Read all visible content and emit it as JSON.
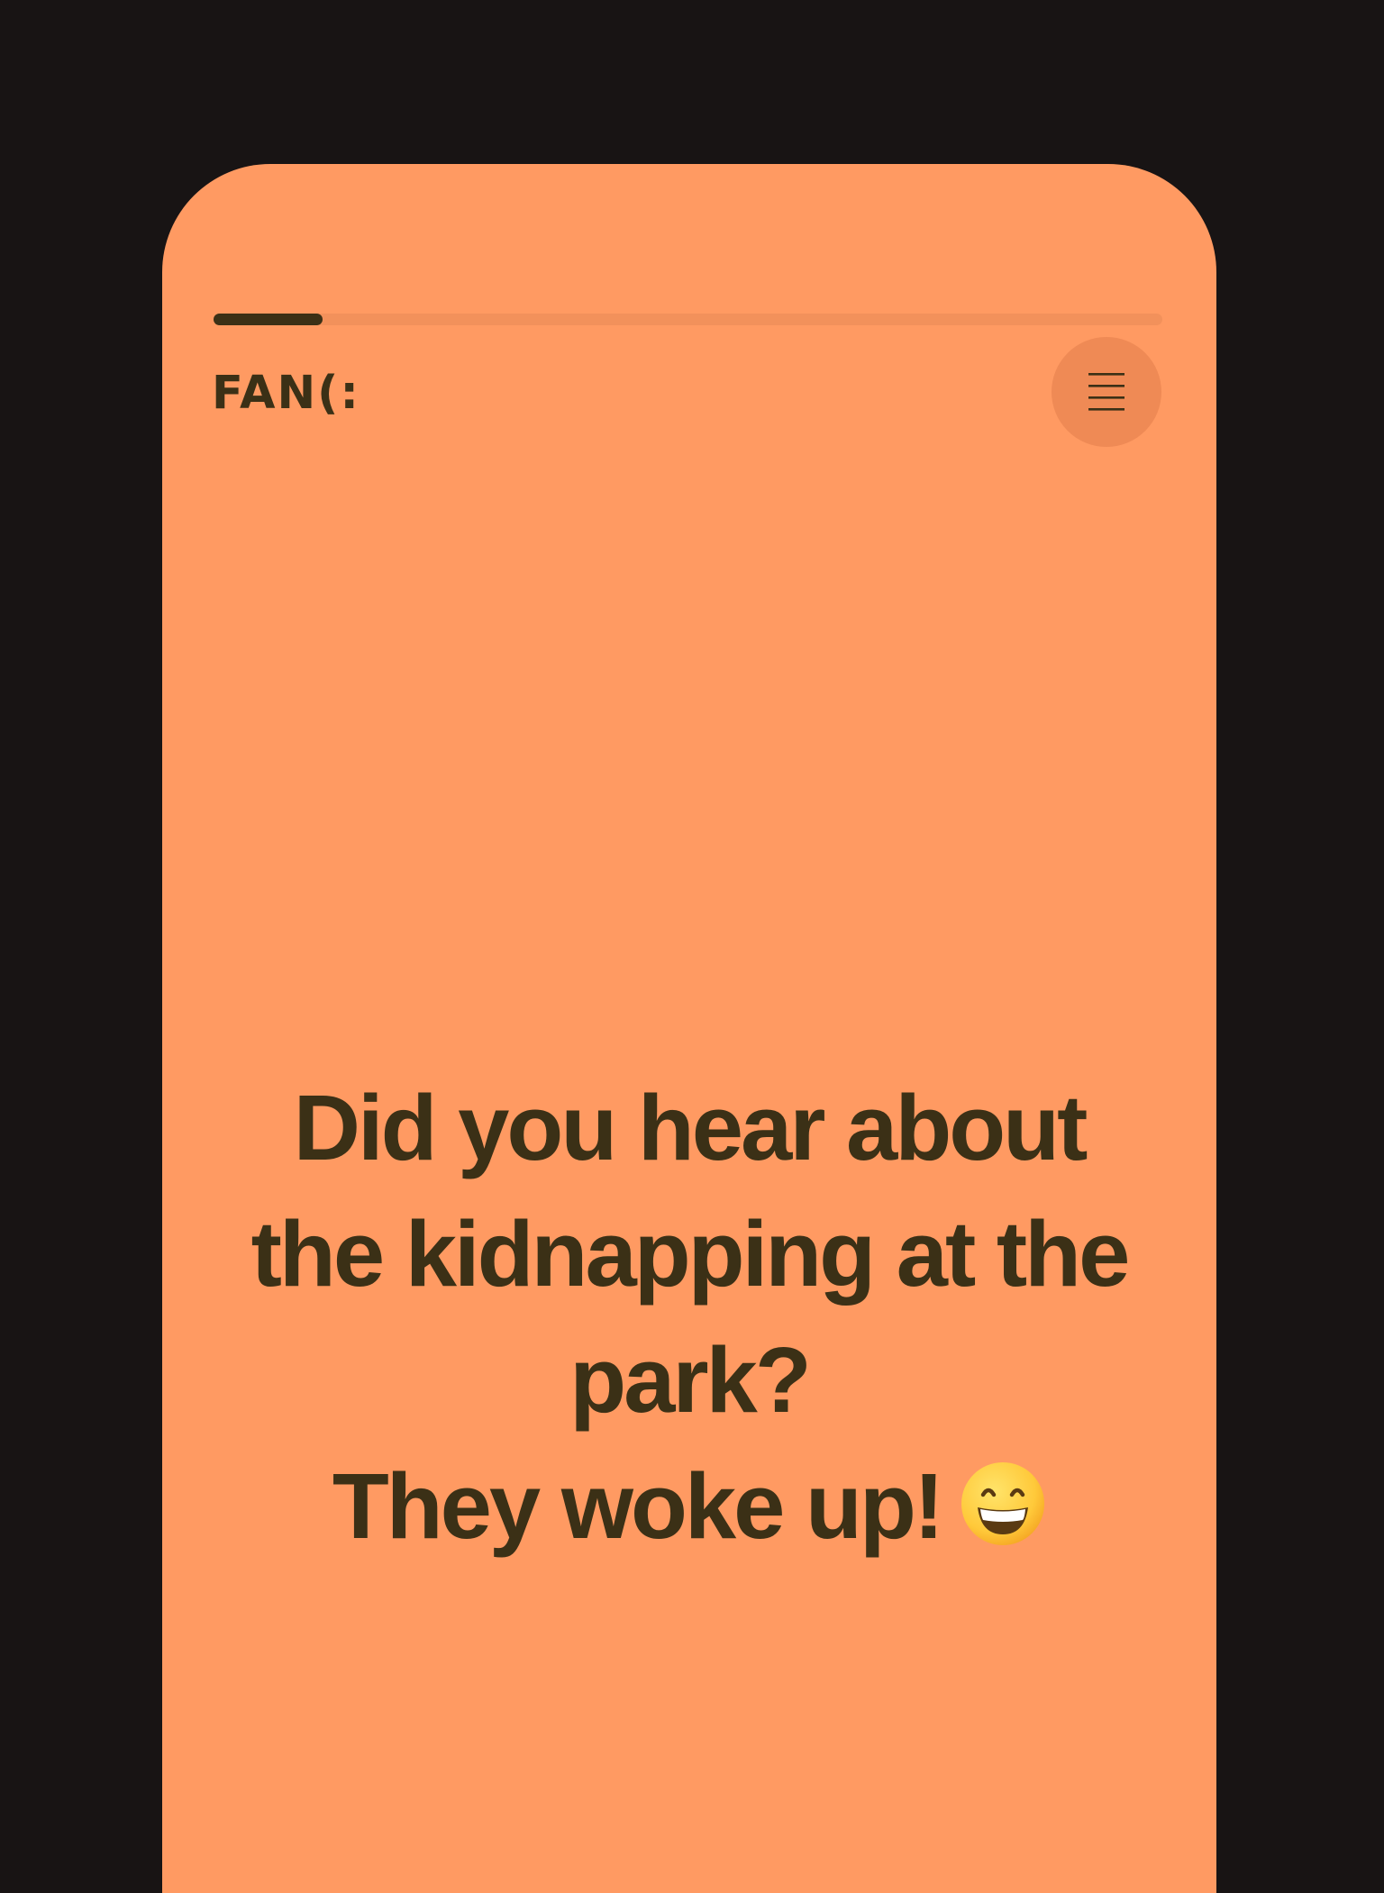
{
  "header": {
    "brand": "FAN(:",
    "menu_icon": "hamburger-menu-icon"
  },
  "progress": {
    "value": 0.115
  },
  "joke": {
    "setup_line_1": "Did you hear about",
    "setup_line_2": "the kidnapping at the",
    "setup_line_3": "park?",
    "punchline": "They woke up!",
    "emoji_icon": "grinning-face-with-smiling-eyes-emoji"
  },
  "colors": {
    "background": "#181414",
    "card": "#ff9a62",
    "text": "#3b3016",
    "menu_button": "#ef8a55",
    "progress_track": "#f2915b"
  }
}
